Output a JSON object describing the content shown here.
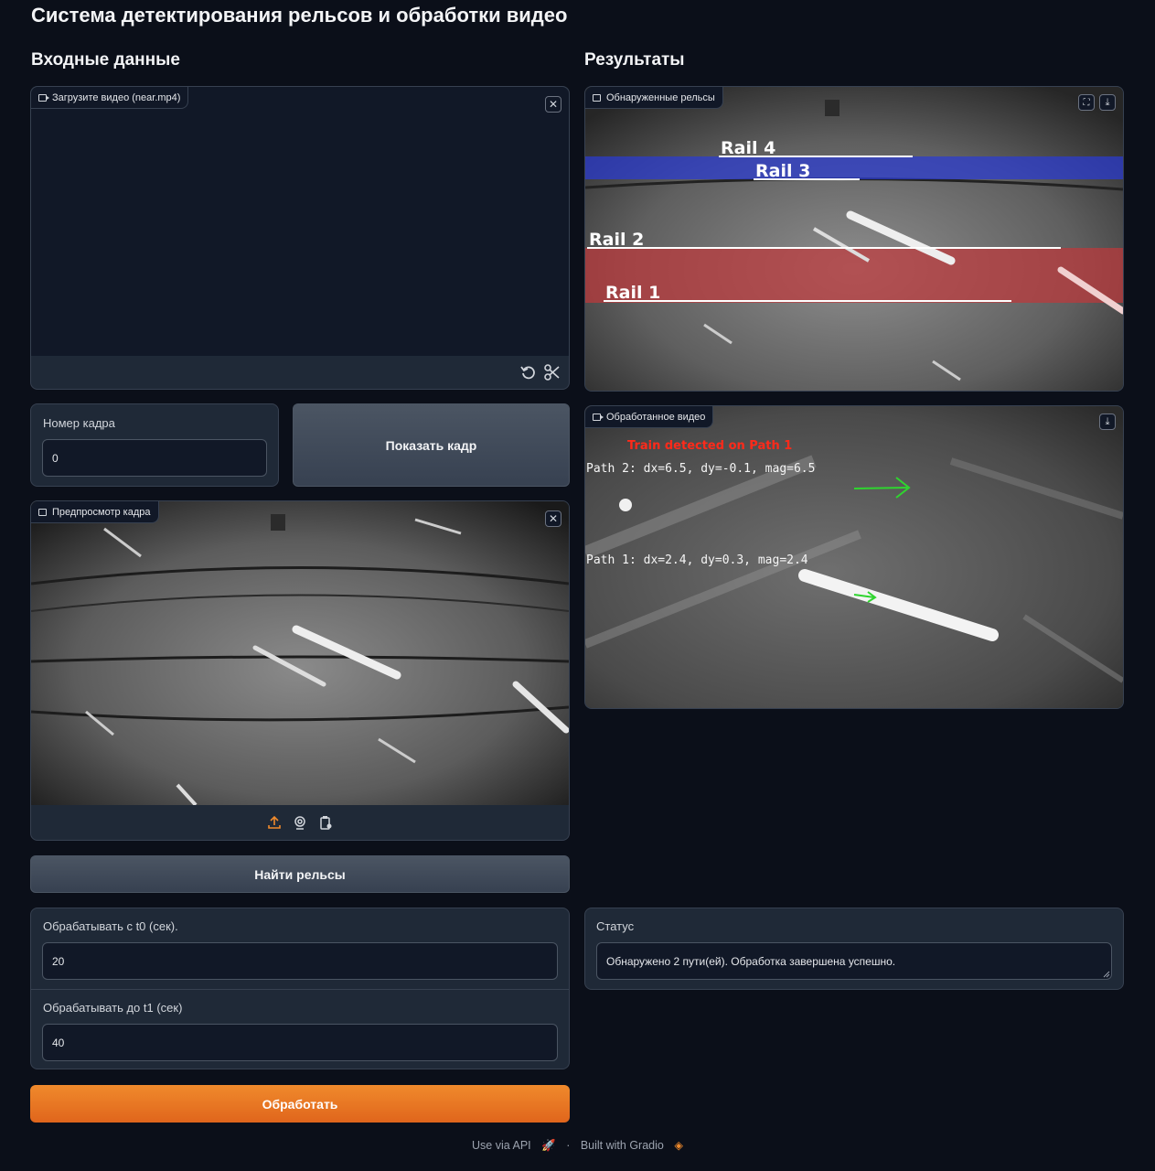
{
  "app": {
    "title": "Система детектирования рельсов и обработки видео"
  },
  "sections": {
    "input": "Входные данные",
    "results": "Результаты"
  },
  "video_upload": {
    "label": "Загрузите видео (near.mp4)"
  },
  "frame_number": {
    "label": "Номер кадра",
    "value": "0"
  },
  "show_frame_button": "Показать кадр",
  "frame_preview": {
    "label": "Предпросмотр кадра"
  },
  "find_rails_button": "Найти рельсы",
  "t0": {
    "label": "Обрабатывать с t0 (сек).",
    "value": "20"
  },
  "t1": {
    "label": "Обрабатывать до t1 (сек)",
    "value": "40"
  },
  "process_button": "Обработать",
  "detected_rails": {
    "label": "Обнаруженные рельсы",
    "rails": [
      "Rail 4",
      "Rail 3",
      "Rail 2",
      "Rail 1"
    ]
  },
  "processed_video": {
    "label": "Обработанное видео",
    "alert": "Train detected on Path 1",
    "path2": "Path 2: dx=6.5, dy=-0.1, mag=6.5",
    "path1": "Path 1: dx=2.4, dy=0.3, mag=2.4"
  },
  "status": {
    "label": "Статус",
    "value": "Обнаружено 2 пути(ей). Обработка завершена успешно."
  },
  "footer": {
    "api": "Use via API",
    "sep": "·",
    "built": "Built with Gradio"
  },
  "colors": {
    "accent": "#e8751f",
    "panel": "#1f2937",
    "bg": "#0b0f19"
  }
}
